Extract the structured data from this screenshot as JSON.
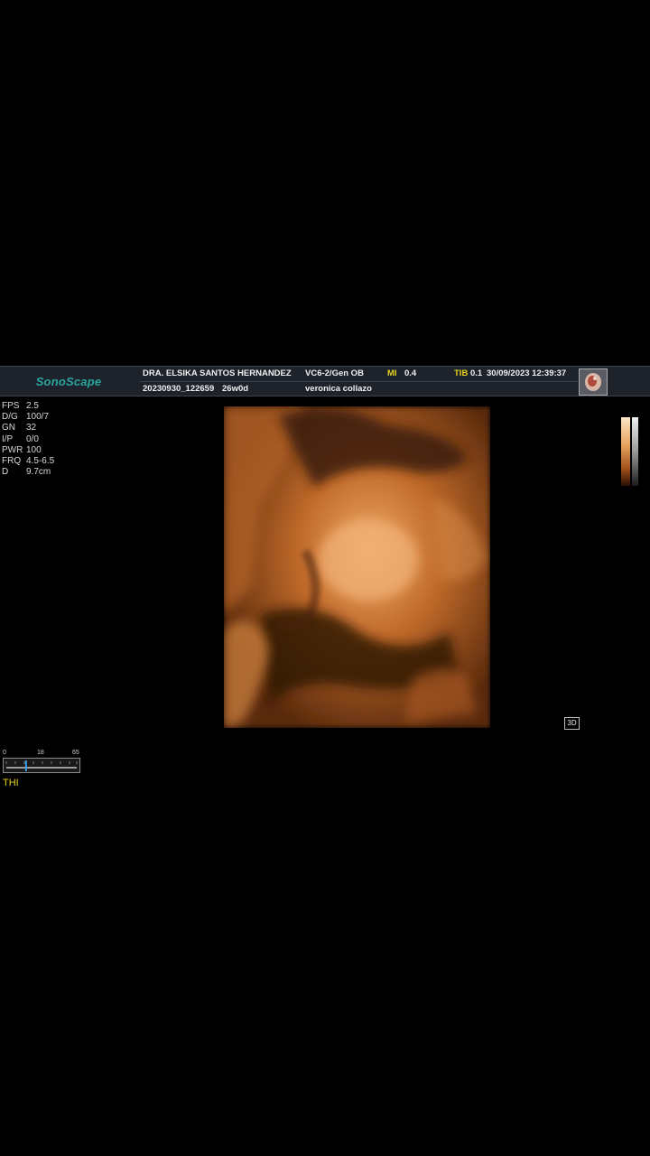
{
  "header": {
    "logo": "SonoScape",
    "doctor": "DRA. ELSIKA SANTOS HERNANDEZ",
    "probe": "VC6-2/Gen OB",
    "mi_label": "MI",
    "mi_value": "0.4",
    "tib_label": "TIB",
    "tib_value": "0.1",
    "datetime": "30/09/2023 12:39:37",
    "exam_id": "20230930_122659",
    "gestational_age": "26w0d",
    "patient": "veronica collazo"
  },
  "params": [
    {
      "key": "FPS",
      "value": "2.5"
    },
    {
      "key": "D/G",
      "value": "100/7"
    },
    {
      "key": "GN",
      "value": "32"
    },
    {
      "key": "I/P",
      "value": "0/0"
    },
    {
      "key": "PWR",
      "value": "100"
    },
    {
      "key": "FRQ",
      "value": "4.5-6.5"
    },
    {
      "key": "D",
      "value": "9.7cm"
    }
  ],
  "mode_badge": "3D",
  "scale": {
    "min": "0",
    "mid": "18",
    "max": "65",
    "level": 0.28
  },
  "thi_label": "THI",
  "colors": {
    "header_bg": "#1d222b",
    "logo": "#2aa5a0",
    "highlight": "#e8d21e",
    "render_tone": "#c06a2a"
  }
}
